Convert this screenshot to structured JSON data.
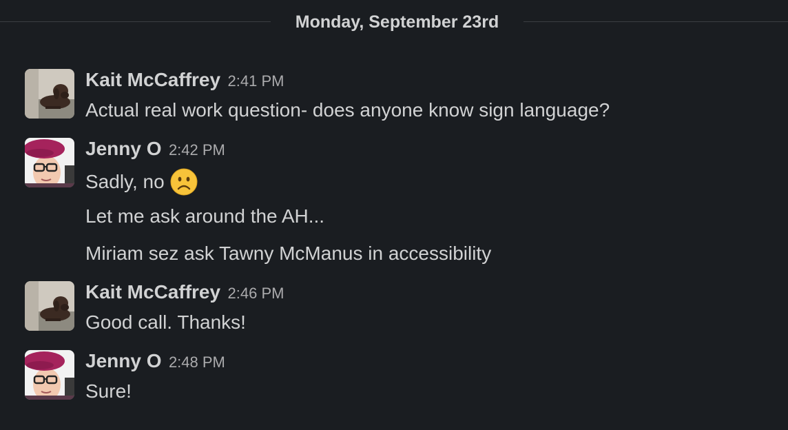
{
  "date_divider": "Monday, September 23rd",
  "messages": [
    {
      "author": "Kait McCaffrey",
      "time": "2:41 PM",
      "avatar": "dog-avatar",
      "lines": [
        "Actual real work question- does anyone know sign language?"
      ]
    },
    {
      "author": "Jenny O",
      "time": "2:42 PM",
      "avatar": "woman-beret-avatar",
      "lines": [
        "Sadly, no",
        "Let me ask around the AH...",
        "Miriam sez ask Tawny McManus in accessibility"
      ],
      "emoji": "frowning-face-emoji"
    },
    {
      "author": "Kait McCaffrey",
      "time": "2:46 PM",
      "avatar": "dog-avatar",
      "lines": [
        "Good call. Thanks!"
      ]
    },
    {
      "author": "Jenny O",
      "time": "2:48 PM",
      "avatar": "woman-beret-avatar",
      "lines": [
        "Sure!"
      ]
    }
  ],
  "colors": {
    "background": "#1a1d21",
    "text": "#d1d2d3",
    "timestamp": "#ababad",
    "divider": "#3b3e43"
  }
}
